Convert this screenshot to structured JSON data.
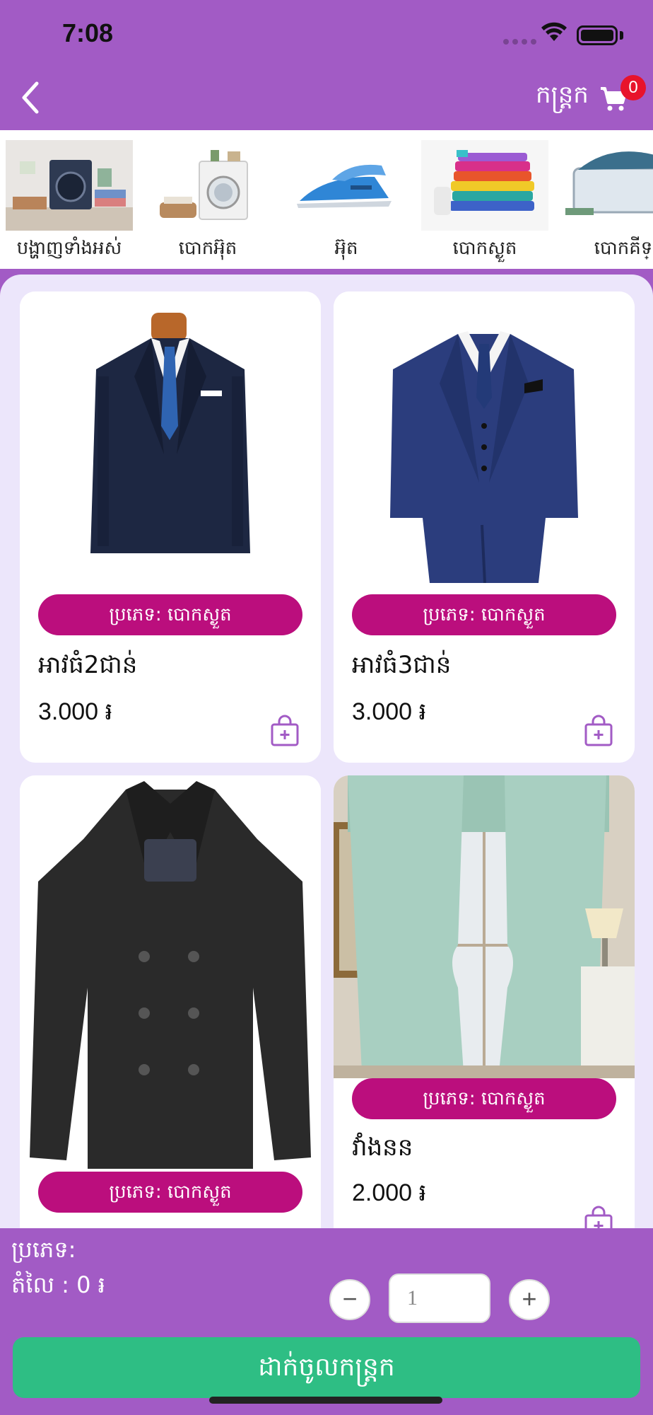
{
  "status_bar": {
    "time": "7:08"
  },
  "header": {
    "cart_label": "កន្ត្រក",
    "cart_count": "0"
  },
  "categories": [
    {
      "label": "បង្ហាញទាំងអស់",
      "icon": "laundry-room-image"
    },
    {
      "label": "បោកអ៊ុត",
      "icon": "washing-machine-image"
    },
    {
      "label": "អ៊ុត",
      "icon": "iron-image"
    },
    {
      "label": "បោកស្ងួត",
      "icon": "folded-clothes-image"
    },
    {
      "label": "បោកគីទ្",
      "icon": "laundry-basket-image"
    }
  ],
  "products": [
    {
      "type": "ប្រភេទ: បោកស្ងួត",
      "name": "អាវធំ2ជាន់",
      "price": "3.000 ៛",
      "image": "navy-two-piece-suit-image"
    },
    {
      "type": "ប្រភេទ: បោកស្ងួត",
      "name": "អាវធំ3ជាន់",
      "price": "3.000 ៛",
      "image": "navy-three-piece-suit-image"
    },
    {
      "type": "ប្រភេទ: បោកស្ងួត",
      "name": "",
      "price": "",
      "image": "black-peacoat-image"
    },
    {
      "type": "ប្រភេទ: បោកស្ងួត",
      "name": "វាំងនន",
      "price": "2.000 ៛",
      "image": "green-curtain-image"
    }
  ],
  "bottom_bar": {
    "type_label": "ប្រភេទ:",
    "price_label": "តំលៃ : 0 ៛",
    "qty_minus": "−",
    "qty_value": "1",
    "qty_plus": "+",
    "add_button": "ដាក់ចូលកន្ត្រក"
  },
  "colors": {
    "primary": "#a25bc5",
    "badge": "#e8132b",
    "pill": "#bb0e7d",
    "button": "#2ebe84",
    "panel": "#ece6fb"
  }
}
